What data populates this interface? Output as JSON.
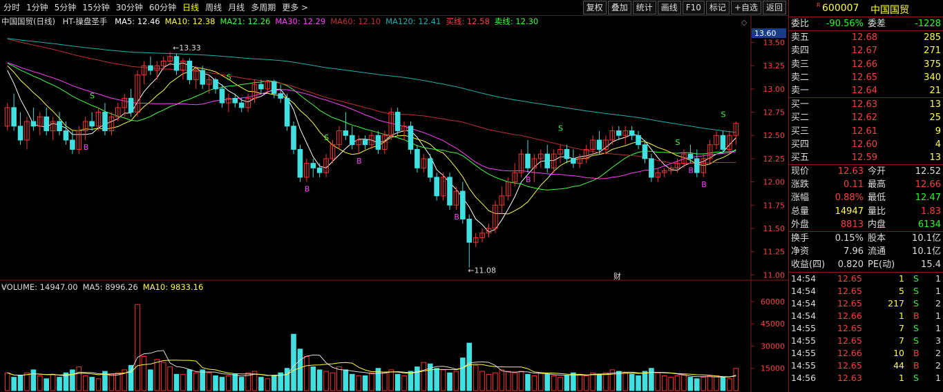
{
  "toolbar": {
    "periods": [
      "分时",
      "1分钟",
      "5分钟",
      "15分钟",
      "30分钟",
      "60分钟",
      "日线",
      "周线",
      "月线",
      "多周期",
      "更多 >"
    ],
    "active_period": "日线",
    "tools": [
      "复权",
      "叠加",
      "统计",
      "画线",
      "F10",
      "标记",
      "+自选",
      "返回"
    ]
  },
  "indicator": {
    "name": "中国国贸(日线)",
    "formula": "HT-操盘圣手",
    "items": [
      {
        "label": "MA5: 12.46",
        "color": "#ffffff"
      },
      {
        "label": "MA10: 12.38",
        "color": "#ffff40"
      },
      {
        "label": "MA21: 12.26",
        "color": "#40ff40"
      },
      {
        "label": "MA30: 12.29",
        "color": "#ff40ff"
      },
      {
        "label": "MA60: 12.10",
        "color": "#c03030"
      },
      {
        "label": "MA120: 12.41",
        "color": "#20b0b0"
      },
      {
        "label": "买线: 12.58",
        "color": "#ff4040"
      },
      {
        "label": "卖线: 12.30",
        "color": "#40ff40"
      }
    ]
  },
  "volume_indicator": {
    "items": [
      {
        "label": "VOLUME: 14947.00",
        "color": "#dddddd"
      },
      {
        "label": "MA5: 8996.26",
        "color": "#dddddd"
      },
      {
        "label": "MA10: 9833.16",
        "color": "#ffff40"
      }
    ]
  },
  "chart_data": {
    "type": "candlestick",
    "price_axis": [
      "13.50",
      "13.25",
      "13.00",
      "12.75",
      "12.50",
      "12.25",
      "12.00",
      "11.75",
      "11.50",
      "11.25",
      "11.00"
    ],
    "price_range": [
      10.95,
      13.66
    ],
    "current_price_tag": "13.60",
    "volume_axis": [
      "60000",
      "45000",
      "30000",
      "15000"
    ],
    "volume_range": [
      0,
      66000
    ],
    "high_label": "13.33",
    "low_label": "11.08",
    "marker_fin": "财",
    "signal_S": "S",
    "signal_B": "B",
    "candles": [
      [
        12.6,
        12.85,
        12.55,
        12.8
      ],
      [
        12.8,
        12.95,
        12.55,
        12.6
      ],
      [
        12.6,
        12.75,
        12.4,
        12.45
      ],
      [
        12.45,
        12.7,
        12.35,
        12.65
      ],
      [
        12.65,
        12.8,
        12.55,
        12.6
      ],
      [
        12.6,
        12.75,
        12.5,
        12.7
      ],
      [
        12.7,
        12.8,
        12.5,
        12.55
      ],
      [
        12.55,
        12.7,
        12.45,
        12.65
      ],
      [
        12.65,
        12.75,
        12.5,
        12.55
      ],
      [
        12.55,
        12.65,
        12.4,
        12.45
      ],
      [
        12.45,
        12.55,
        12.3,
        12.35
      ],
      [
        12.35,
        12.6,
        12.3,
        12.55
      ],
      [
        12.55,
        12.7,
        12.45,
        12.65
      ],
      [
        12.65,
        12.75,
        12.55,
        12.6
      ],
      [
        12.6,
        12.8,
        12.55,
        12.75
      ],
      [
        12.75,
        12.85,
        12.5,
        12.55
      ],
      [
        12.55,
        12.75,
        12.5,
        12.7
      ],
      [
        12.7,
        12.85,
        12.65,
        12.8
      ],
      [
        12.8,
        12.95,
        12.7,
        12.9
      ],
      [
        12.9,
        13.0,
        12.7,
        12.75
      ],
      [
        12.75,
        13.2,
        12.7,
        13.15
      ],
      [
        13.15,
        13.3,
        13.05,
        13.25
      ],
      [
        13.25,
        13.35,
        13.15,
        13.2
      ],
      [
        13.2,
        13.3,
        13.1,
        13.25
      ],
      [
        13.25,
        13.35,
        13.2,
        13.3
      ],
      [
        13.3,
        13.4,
        13.25,
        13.35
      ],
      [
        13.35,
        13.38,
        13.15,
        13.2
      ],
      [
        13.2,
        13.33,
        13.1,
        13.3
      ],
      [
        13.3,
        13.33,
        13.05,
        13.1
      ],
      [
        13.1,
        13.25,
        13.0,
        13.2
      ],
      [
        13.2,
        13.25,
        13.0,
        13.05
      ],
      [
        13.05,
        13.15,
        12.95,
        13.1
      ],
      [
        13.1,
        13.12,
        12.95,
        13.0
      ],
      [
        13.0,
        13.05,
        12.8,
        12.85
      ],
      [
        12.85,
        12.95,
        12.75,
        12.9
      ],
      [
        12.9,
        12.95,
        12.8,
        12.85
      ],
      [
        12.85,
        12.9,
        12.75,
        12.8
      ],
      [
        12.8,
        12.95,
        12.75,
        12.9
      ],
      [
        12.9,
        13.1,
        12.85,
        13.05
      ],
      [
        13.05,
        13.1,
        12.95,
        13.0
      ],
      [
        13.0,
        13.1,
        12.95,
        13.08
      ],
      [
        13.08,
        13.1,
        12.9,
        12.95
      ],
      [
        12.95,
        13.05,
        12.85,
        12.9
      ],
      [
        12.9,
        12.95,
        12.55,
        12.6
      ],
      [
        12.6,
        12.65,
        12.3,
        12.35
      ],
      [
        12.35,
        12.4,
        12.0,
        12.05
      ],
      [
        12.05,
        12.25,
        12.0,
        12.2
      ],
      [
        12.2,
        12.25,
        12.05,
        12.15
      ],
      [
        12.15,
        12.2,
        12.05,
        12.1
      ],
      [
        12.1,
        12.3,
        12.05,
        12.25
      ],
      [
        12.25,
        12.45,
        12.2,
        12.4
      ],
      [
        12.4,
        12.6,
        12.35,
        12.55
      ],
      [
        12.55,
        12.75,
        12.45,
        12.5
      ],
      [
        12.5,
        12.6,
        12.35,
        12.4
      ],
      [
        12.4,
        12.5,
        12.3,
        12.45
      ],
      [
        12.45,
        12.5,
        12.35,
        12.4
      ],
      [
        12.4,
        12.55,
        12.35,
        12.5
      ],
      [
        12.5,
        12.55,
        12.3,
        12.35
      ],
      [
        12.35,
        12.55,
        12.3,
        12.5
      ],
      [
        12.5,
        12.8,
        12.45,
        12.75
      ],
      [
        12.75,
        12.8,
        12.5,
        12.55
      ],
      [
        12.55,
        12.65,
        12.45,
        12.6
      ],
      [
        12.6,
        12.65,
        12.3,
        12.35
      ],
      [
        12.35,
        12.4,
        12.1,
        12.15
      ],
      [
        12.15,
        12.3,
        12.1,
        12.25
      ],
      [
        12.25,
        12.3,
        12.0,
        12.05
      ],
      [
        12.05,
        12.1,
        11.8,
        11.85
      ],
      [
        11.85,
        12.1,
        11.8,
        12.05
      ],
      [
        12.05,
        12.1,
        11.7,
        11.75
      ],
      [
        11.75,
        11.95,
        11.7,
        11.9
      ],
      [
        11.9,
        12.0,
        11.55,
        11.6
      ],
      [
        11.6,
        11.65,
        11.08,
        11.35
      ],
      [
        11.35,
        11.45,
        11.3,
        11.4
      ],
      [
        11.4,
        11.5,
        11.35,
        11.45
      ],
      [
        11.45,
        11.55,
        11.4,
        11.5
      ],
      [
        11.5,
        11.8,
        11.45,
        11.75
      ],
      [
        11.75,
        11.95,
        11.65,
        11.85
      ],
      [
        11.85,
        12.05,
        11.8,
        12.0
      ],
      [
        12.0,
        12.2,
        11.95,
        12.1
      ],
      [
        12.1,
        12.35,
        12.05,
        12.3
      ],
      [
        12.3,
        12.45,
        12.1,
        12.15
      ],
      [
        12.15,
        12.3,
        12.0,
        12.25
      ],
      [
        12.25,
        12.35,
        12.15,
        12.3
      ],
      [
        12.3,
        12.4,
        12.1,
        12.15
      ],
      [
        12.15,
        12.35,
        12.1,
        12.3
      ],
      [
        12.3,
        12.4,
        12.2,
        12.35
      ],
      [
        12.35,
        12.4,
        12.2,
        12.25
      ],
      [
        12.25,
        12.35,
        12.15,
        12.2
      ],
      [
        12.2,
        12.3,
        12.15,
        12.25
      ],
      [
        12.25,
        12.4,
        12.2,
        12.35
      ],
      [
        12.35,
        12.5,
        12.3,
        12.45
      ],
      [
        12.45,
        12.55,
        12.3,
        12.35
      ],
      [
        12.35,
        12.5,
        12.3,
        12.45
      ],
      [
        12.45,
        12.6,
        12.4,
        12.55
      ],
      [
        12.55,
        12.6,
        12.45,
        12.5
      ],
      [
        12.5,
        12.6,
        12.4,
        12.55
      ],
      [
        12.55,
        12.6,
        12.45,
        12.5
      ],
      [
        12.5,
        12.55,
        12.35,
        12.4
      ],
      [
        12.4,
        12.45,
        12.2,
        12.25
      ],
      [
        12.25,
        12.3,
        12.0,
        12.05
      ],
      [
        12.05,
        12.15,
        12.0,
        12.1
      ],
      [
        12.1,
        12.15,
        12.05,
        12.12
      ],
      [
        12.12,
        12.18,
        12.08,
        12.15
      ],
      [
        12.15,
        12.25,
        12.1,
        12.2
      ],
      [
        12.2,
        12.35,
        12.15,
        12.3
      ],
      [
        12.3,
        12.4,
        12.2,
        12.25
      ],
      [
        12.25,
        12.35,
        12.05,
        12.1
      ],
      [
        12.1,
        12.3,
        12.05,
        12.25
      ],
      [
        12.25,
        12.45,
        12.2,
        12.4
      ],
      [
        12.4,
        12.55,
        12.35,
        12.5
      ],
      [
        12.5,
        12.55,
        12.3,
        12.35
      ],
      [
        12.35,
        12.55,
        12.3,
        12.5
      ],
      [
        12.5,
        12.65,
        12.4,
        12.63
      ]
    ],
    "volumes": [
      12000,
      9000,
      10000,
      12000,
      14000,
      10000,
      8000,
      11000,
      9000,
      12000,
      14000,
      16000,
      10000,
      9000,
      8000,
      13000,
      11000,
      12000,
      14000,
      17000,
      58000,
      23000,
      14000,
      21000,
      19000,
      16000,
      11000,
      11000,
      14000,
      12000,
      14000,
      12000,
      10000,
      9000,
      10000,
      11000,
      9000,
      12000,
      13000,
      9000,
      8000,
      10000,
      12000,
      15000,
      38000,
      28000,
      23000,
      16000,
      14000,
      13000,
      12000,
      16000,
      14000,
      11000,
      10000,
      10000,
      12000,
      15000,
      12000,
      14000,
      11000,
      10000,
      13000,
      16000,
      19000,
      18000,
      15000,
      14000,
      12000,
      13000,
      22000,
      32000,
      17000,
      13000,
      11000,
      12000,
      14000,
      13000,
      12000,
      13000,
      11000,
      10000,
      12000,
      11000,
      10000,
      9000,
      10000,
      12000,
      11000,
      10000,
      12000,
      11000,
      12000,
      14000,
      13000,
      12000,
      11000,
      10000,
      13000,
      15000,
      12000,
      10000,
      9000,
      10000,
      11000,
      9000,
      8000,
      9000,
      10000,
      10000,
      9000,
      8000,
      14947
    ],
    "ma_lines": [
      {
        "name": "MA5",
        "color": "#ffffff"
      },
      {
        "name": "MA10",
        "color": "#ffff40"
      },
      {
        "name": "MA21",
        "color": "#40ff40"
      },
      {
        "name": "MA30",
        "color": "#ff40ff"
      },
      {
        "name": "MA60",
        "color": "#c03030"
      },
      {
        "name": "MA120",
        "color": "#20b0b0"
      }
    ]
  },
  "panel": {
    "code": "600007",
    "name": "中国国贸",
    "ratio_label": "委比",
    "ratio_value": "-90.56%",
    "diff_label": "委差",
    "diff_value": "-1228",
    "asks": [
      {
        "label": "卖五",
        "price": "12.68",
        "qty": "285"
      },
      {
        "label": "卖四",
        "price": "12.67",
        "qty": "271"
      },
      {
        "label": "卖三",
        "price": "12.66",
        "qty": "375"
      },
      {
        "label": "卖二",
        "price": "12.65",
        "qty": "340"
      },
      {
        "label": "卖一",
        "price": "12.64",
        "qty": "21"
      }
    ],
    "bids": [
      {
        "label": "买一",
        "price": "12.63",
        "qty": "13"
      },
      {
        "label": "买二",
        "price": "12.62",
        "qty": "25"
      },
      {
        "label": "买三",
        "price": "12.61",
        "qty": "9"
      },
      {
        "label": "买四",
        "price": "12.60",
        "qty": "4"
      },
      {
        "label": "买五",
        "price": "12.59",
        "qty": "13"
      }
    ],
    "stats": [
      {
        "l1": "现价",
        "v1": "12.63",
        "c1": "red",
        "l2": "今开",
        "v2": "12.52",
        "c2": "white"
      },
      {
        "l1": "涨跌",
        "v1": "0.11",
        "c1": "red",
        "l2": "最高",
        "v2": "12.66",
        "c2": "red"
      },
      {
        "l1": "涨幅",
        "v1": "0.88%",
        "c1": "red",
        "l2": "最低",
        "v2": "12.47",
        "c2": "green"
      },
      {
        "l1": "总量",
        "v1": "14947",
        "c1": "yellow",
        "l2": "量比",
        "v2": "1.83",
        "c2": "red"
      },
      {
        "l1": "外盘",
        "v1": "8813",
        "c1": "red",
        "l2": "内盘",
        "v2": "6134",
        "c2": "green"
      }
    ],
    "stats2": [
      {
        "l1": "换手",
        "v1": "0.15%",
        "l2": "股本",
        "v2": "10.1亿"
      },
      {
        "l1": "净资",
        "v1": "7.96",
        "l2": "流通",
        "v2": "10.1亿"
      },
      {
        "l1": "收益(四)",
        "v1": "0.820",
        "l2": "PE(动)",
        "v2": "15.4"
      }
    ],
    "ticks": [
      {
        "time": "14:54",
        "price": "12.65",
        "qty": "1",
        "dir": "S",
        "n": "1"
      },
      {
        "time": "14:54",
        "price": "12.65",
        "qty": "5",
        "dir": "S",
        "n": "1"
      },
      {
        "time": "14:54",
        "price": "12.65",
        "qty": "217",
        "dir": "S",
        "n": "2"
      },
      {
        "time": "14:54",
        "price": "12.66",
        "qty": "1",
        "dir": "B",
        "n": "1"
      },
      {
        "time": "14:55",
        "price": "12.65",
        "qty": "7",
        "dir": "S",
        "n": "1"
      },
      {
        "time": "14:55",
        "price": "12.65",
        "qty": "7",
        "dir": "S",
        "n": "3"
      },
      {
        "time": "14:55",
        "price": "12.66",
        "qty": "10",
        "dir": "B",
        "n": "2"
      },
      {
        "time": "14:55",
        "price": "12.65",
        "qty": "44",
        "dir": "B",
        "n": "2"
      },
      {
        "time": "14:56",
        "price": "12.63",
        "qty": "1",
        "dir": "S",
        "n": "1"
      }
    ]
  }
}
